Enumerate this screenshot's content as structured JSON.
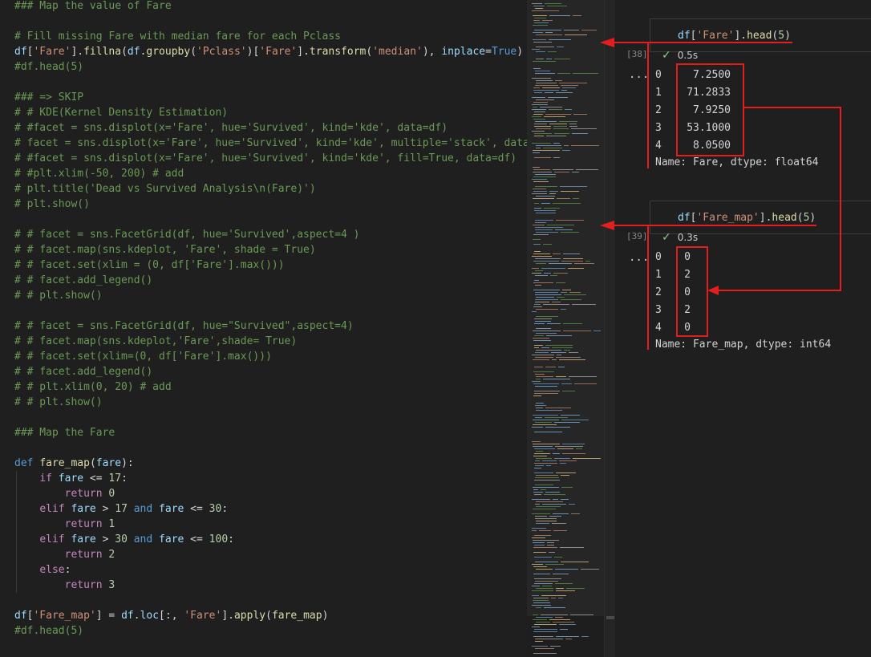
{
  "editor": {
    "lines": [
      [
        [
          "cmt",
          "### Map the value of Fare"
        ]
      ],
      [],
      [
        [
          "cmt",
          "# Fill missing Fare with median fare for each Pclass"
        ]
      ],
      [
        [
          "var",
          "df"
        ],
        [
          "txt",
          "["
        ],
        [
          "str",
          "'Fare'"
        ],
        [
          "txt",
          "]."
        ],
        [
          "fn",
          "fillna"
        ],
        [
          "txt",
          "("
        ],
        [
          "var",
          "df"
        ],
        [
          "txt",
          "."
        ],
        [
          "fn",
          "groupby"
        ],
        [
          "txt",
          "("
        ],
        [
          "str",
          "'Pclass'"
        ],
        [
          "txt",
          ")["
        ],
        [
          "str",
          "'Fare'"
        ],
        [
          "txt",
          "]."
        ],
        [
          "fn",
          "transform"
        ],
        [
          "txt",
          "("
        ],
        [
          "str",
          "'median'"
        ],
        [
          "txt",
          "), "
        ],
        [
          "var",
          "inplace"
        ],
        [
          "txt",
          "="
        ],
        [
          "kw",
          "True"
        ],
        [
          "txt",
          ")"
        ]
      ],
      [
        [
          "cmt",
          "#df.head(5)"
        ]
      ],
      [],
      [
        [
          "cmt",
          "### => SKIP"
        ]
      ],
      [
        [
          "cmt",
          "# # KDE(Kernel Density Estimation)"
        ]
      ],
      [
        [
          "cmt",
          "# #facet = sns.displot(x='Fare', hue='Survived', kind='kde', data=df)"
        ]
      ],
      [
        [
          "cmt",
          "# facet = sns.displot(x='Fare', hue='Survived', kind='kde', multiple='stack', data=df)"
        ]
      ],
      [
        [
          "cmt",
          "# #facet = sns.displot(x='Fare', hue='Survived', kind='kde', fill=True, data=df)"
        ]
      ],
      [
        [
          "cmt",
          "# #plt.xlim(-50, 200) # add"
        ]
      ],
      [
        [
          "cmt",
          "# plt.title('Dead vs Survived Analysis\\n(Fare)')"
        ]
      ],
      [
        [
          "cmt",
          "# plt.show()"
        ]
      ],
      [],
      [
        [
          "cmt",
          "# # facet = sns.FacetGrid(df, hue='Survived',aspect=4 )"
        ]
      ],
      [
        [
          "cmt",
          "# # facet.map(sns.kdeplot, 'Fare', shade = True)"
        ]
      ],
      [
        [
          "cmt",
          "# # facet.set(xlim = (0, df['Fare'].max()))"
        ]
      ],
      [
        [
          "cmt",
          "# # facet.add_legend()"
        ]
      ],
      [
        [
          "cmt",
          "# # plt.show()"
        ]
      ],
      [],
      [
        [
          "cmt",
          "# # facet = sns.FacetGrid(df, hue=\"Survived\",aspect=4)"
        ]
      ],
      [
        [
          "cmt",
          "# # facet.map(sns.kdeplot,'Fare',shade= True)"
        ]
      ],
      [
        [
          "cmt",
          "# # facet.set(xlim=(0, df['Fare'].max()))"
        ]
      ],
      [
        [
          "cmt",
          "# # facet.add_legend()"
        ]
      ],
      [
        [
          "cmt",
          "# # plt.xlim(0, 20) # add"
        ]
      ],
      [
        [
          "cmt",
          "# # plt.show()"
        ]
      ],
      [],
      [
        [
          "cmt",
          "### Map the Fare"
        ]
      ],
      [],
      [
        [
          "kw",
          "def "
        ],
        [
          "fn",
          "fare_map"
        ],
        [
          "txt",
          "("
        ],
        [
          "var",
          "fare"
        ],
        [
          "txt",
          "):"
        ]
      ],
      [
        [
          "txt",
          "    "
        ],
        [
          "ctl",
          "if "
        ],
        [
          "var",
          "fare"
        ],
        [
          "txt",
          " <= "
        ],
        [
          "num",
          "17"
        ],
        [
          "txt",
          ":"
        ]
      ],
      [
        [
          "txt",
          "        "
        ],
        [
          "ctl",
          "return "
        ],
        [
          "num",
          "0"
        ]
      ],
      [
        [
          "txt",
          "    "
        ],
        [
          "ctl",
          "elif "
        ],
        [
          "var",
          "fare"
        ],
        [
          "txt",
          " > "
        ],
        [
          "num",
          "17"
        ],
        [
          "kw",
          " and "
        ],
        [
          "var",
          "fare"
        ],
        [
          "txt",
          " <= "
        ],
        [
          "num",
          "30"
        ],
        [
          "txt",
          ":"
        ]
      ],
      [
        [
          "txt",
          "        "
        ],
        [
          "ctl",
          "return "
        ],
        [
          "num",
          "1"
        ]
      ],
      [
        [
          "txt",
          "    "
        ],
        [
          "ctl",
          "elif "
        ],
        [
          "var",
          "fare"
        ],
        [
          "txt",
          " > "
        ],
        [
          "num",
          "30"
        ],
        [
          "kw",
          " and "
        ],
        [
          "var",
          "fare"
        ],
        [
          "txt",
          " <= "
        ],
        [
          "num",
          "100"
        ],
        [
          "txt",
          ":"
        ]
      ],
      [
        [
          "txt",
          "        "
        ],
        [
          "ctl",
          "return "
        ],
        [
          "num",
          "2"
        ]
      ],
      [
        [
          "txt",
          "    "
        ],
        [
          "ctl",
          "else"
        ],
        [
          "txt",
          ":"
        ]
      ],
      [
        [
          "txt",
          "        "
        ],
        [
          "ctl",
          "return "
        ],
        [
          "num",
          "3"
        ]
      ],
      [],
      [
        [
          "var",
          "df"
        ],
        [
          "txt",
          "["
        ],
        [
          "str",
          "'Fare_map'"
        ],
        [
          "txt",
          "] = "
        ],
        [
          "var",
          "df"
        ],
        [
          "txt",
          "."
        ],
        [
          "var",
          "loc"
        ],
        [
          "txt",
          "[:, "
        ],
        [
          "str",
          "'Fare'"
        ],
        [
          "txt",
          "]."
        ],
        [
          "fn",
          "apply"
        ],
        [
          "txt",
          "("
        ],
        [
          "fn",
          "fare_map"
        ],
        [
          "txt",
          ")"
        ]
      ],
      [
        [
          "cmt",
          "#df.head(5)"
        ]
      ]
    ]
  },
  "output": {
    "cells": [
      {
        "exec_count": "[38]",
        "status_check": "✓",
        "status_time": "0.5s",
        "code": [
          [
            "var",
            "df"
          ],
          [
            "txt",
            "["
          ],
          [
            "str",
            "'Fare'"
          ],
          [
            "txt",
            "]."
          ],
          [
            "fn",
            "head"
          ],
          [
            "txt",
            "("
          ],
          [
            "num",
            "5"
          ],
          [
            "txt",
            ")"
          ]
        ],
        "ellipsis": "...",
        "rows": [
          {
            "index": "0",
            "value": "7.2500"
          },
          {
            "index": "1",
            "value": "71.2833"
          },
          {
            "index": "2",
            "value": "7.9250"
          },
          {
            "index": "3",
            "value": "53.1000"
          },
          {
            "index": "4",
            "value": "8.0500"
          }
        ],
        "meta": "Name: Fare, dtype: float64"
      },
      {
        "exec_count": "[39]",
        "status_check": "✓",
        "status_time": "0.3s",
        "code": [
          [
            "var",
            "df"
          ],
          [
            "txt",
            "["
          ],
          [
            "str",
            "'Fare_map'"
          ],
          [
            "txt",
            "]."
          ],
          [
            "fn",
            "head"
          ],
          [
            "txt",
            "("
          ],
          [
            "num",
            "5"
          ],
          [
            "txt",
            ")"
          ]
        ],
        "ellipsis": "...",
        "rows": [
          {
            "index": "0",
            "value": "0"
          },
          {
            "index": "1",
            "value": "2"
          },
          {
            "index": "2",
            "value": "0"
          },
          {
            "index": "3",
            "value": "2"
          },
          {
            "index": "4",
            "value": "0"
          }
        ],
        "meta": "Name: Fare_map, dtype: int64"
      }
    ]
  },
  "colors": {
    "annotation": "#e41e1e",
    "comment": "#6a9955",
    "keyword": "#569cd6",
    "string": "#ce9178",
    "function": "#dcdcaa",
    "variable": "#9cdcfe",
    "number": "#b5cea8",
    "control": "#c586c0"
  }
}
